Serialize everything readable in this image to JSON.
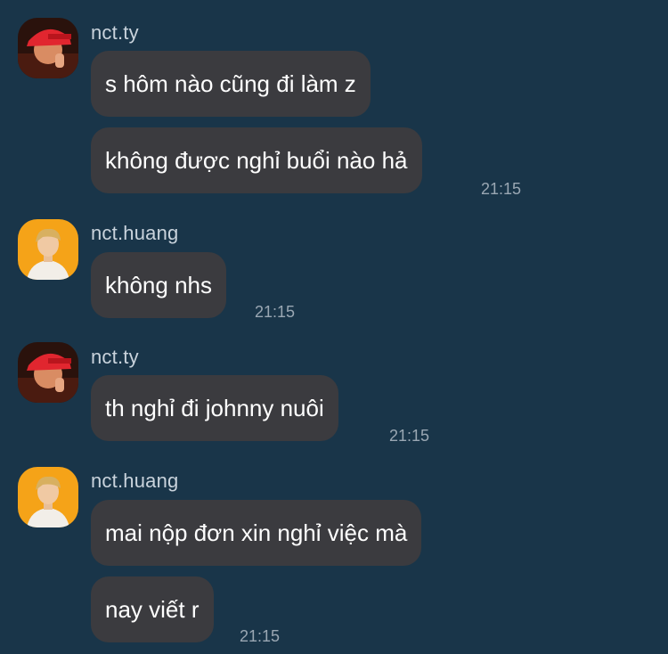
{
  "messages": [
    {
      "sender": "nct.ty",
      "texts": [
        "s hôm nào cũng đi làm z",
        "không được nghỉ buổi nào hả"
      ],
      "time": "21:15"
    },
    {
      "sender": "nct.huang",
      "texts": [
        "không nhs"
      ],
      "time": "21:15"
    },
    {
      "sender": "nct.ty",
      "texts": [
        "th nghỉ đi johnny nuôi"
      ],
      "time": "21:15"
    },
    {
      "sender": "nct.huang",
      "texts": [
        "mai nộp đơn xin nghỉ việc mà",
        "nay viết r"
      ],
      "time": "21:15"
    }
  ]
}
